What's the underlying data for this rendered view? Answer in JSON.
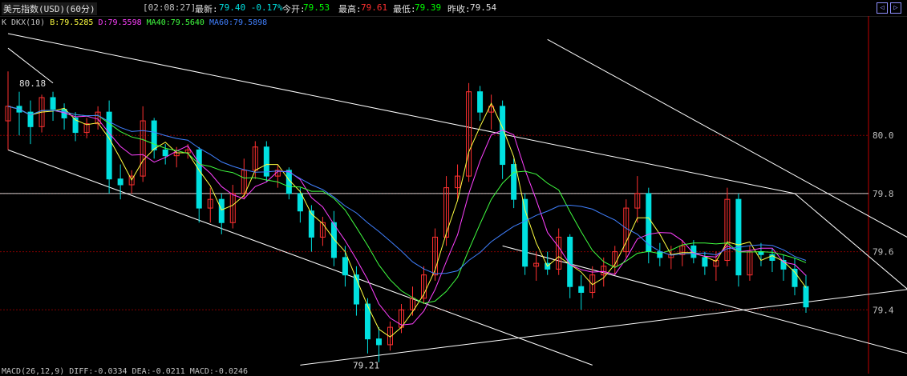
{
  "header": {
    "instrument": "美元指数(USD)(60分)",
    "time": "[02:08:27]",
    "last_label": "最新:",
    "last_value": "79.40 -0.17%",
    "open_label": "今开:",
    "open_value": "79.53",
    "high_label": "最高:",
    "high_value": "79.61",
    "low_label": "最低:",
    "low_value": "79.39",
    "prev_label": "昨收:",
    "prev_value": "79.54"
  },
  "nav": {
    "prev_icon": "◁",
    "next_icon": "▷"
  },
  "legend": {
    "prefix": "K  DKX(10) ",
    "b": "B:79.5285",
    "d": "D:79.5598",
    "ma40": "MA40:79.5640",
    "ma60": "MA60:79.5898"
  },
  "macd_text": "MACD(26,12,9) DIFF:-0.0334  DEA:-0.0211  MACD:-0.0246",
  "colors": {
    "up": "#ff3030",
    "down": "#00e0e0",
    "b_line": "#ffff40",
    "d_line": "#ff40ff",
    "ma40": "#40ff40",
    "ma60": "#4080ff",
    "grid": "#800000",
    "trend": "#ffffff"
  },
  "chart_data": {
    "type": "candlestick",
    "title": "美元指数(USD)(60分)",
    "ylim": [
      79.2,
      80.35
    ],
    "yticks": [
      80.0,
      79.8,
      79.6,
      79.4
    ],
    "ytick_labels": [
      "80.0",
      "79.8",
      "79.6",
      "79.4"
    ],
    "annotations": [
      {
        "text": "80.18",
        "value": 80.18
      },
      {
        "text": "79.21",
        "value": 79.21
      }
    ],
    "candles": [
      [
        80.05,
        80.22,
        79.95,
        80.1
      ],
      [
        80.1,
        80.15,
        80.0,
        80.08
      ],
      [
        80.08,
        80.12,
        79.97,
        80.03
      ],
      [
        80.03,
        80.14,
        80.01,
        80.13
      ],
      [
        80.13,
        80.15,
        80.05,
        80.09
      ],
      [
        80.09,
        80.11,
        80.02,
        80.06
      ],
      [
        80.06,
        80.08,
        79.98,
        80.01
      ],
      [
        80.01,
        80.06,
        79.99,
        80.04
      ],
      [
        80.04,
        80.1,
        80.02,
        80.08
      ],
      [
        80.08,
        80.12,
        79.8,
        79.85
      ],
      [
        79.85,
        79.9,
        79.78,
        79.83
      ],
      [
        79.83,
        79.88,
        79.8,
        79.86
      ],
      [
        79.86,
        80.1,
        79.84,
        80.05
      ],
      [
        80.05,
        80.06,
        79.92,
        79.95
      ],
      [
        79.95,
        79.97,
        79.9,
        79.93
      ],
      [
        79.93,
        79.96,
        79.89,
        79.94
      ],
      [
        79.94,
        79.97,
        79.92,
        79.95
      ],
      [
        79.95,
        79.96,
        79.7,
        79.75
      ],
      [
        79.75,
        79.82,
        79.7,
        79.78
      ],
      [
        79.78,
        79.8,
        79.66,
        79.7
      ],
      [
        79.7,
        79.83,
        79.68,
        79.8
      ],
      [
        79.8,
        79.92,
        79.78,
        79.88
      ],
      [
        79.88,
        79.98,
        79.85,
        79.96
      ],
      [
        79.96,
        79.98,
        79.84,
        79.86
      ],
      [
        79.86,
        79.9,
        79.82,
        79.88
      ],
      [
        79.88,
        79.89,
        79.78,
        79.8
      ],
      [
        79.8,
        79.82,
        79.7,
        79.74
      ],
      [
        79.74,
        79.76,
        79.6,
        79.65
      ],
      [
        79.65,
        79.72,
        79.62,
        79.7
      ],
      [
        79.7,
        79.74,
        79.55,
        79.58
      ],
      [
        79.58,
        79.62,
        79.48,
        79.52
      ],
      [
        79.52,
        79.55,
        79.38,
        79.42
      ],
      [
        79.42,
        79.44,
        79.25,
        79.3
      ],
      [
        79.3,
        79.34,
        79.22,
        79.28
      ],
      [
        79.28,
        79.36,
        79.26,
        79.34
      ],
      [
        79.34,
        79.42,
        79.32,
        79.4
      ],
      [
        79.4,
        79.48,
        79.38,
        79.44
      ],
      [
        79.44,
        79.55,
        79.42,
        79.52
      ],
      [
        79.52,
        79.68,
        79.5,
        79.65
      ],
      [
        79.65,
        79.86,
        79.62,
        79.82
      ],
      [
        79.82,
        79.9,
        79.78,
        79.86
      ],
      [
        79.86,
        80.18,
        79.84,
        80.15
      ],
      [
        80.15,
        80.17,
        80.05,
        80.08
      ],
      [
        80.08,
        80.14,
        80.02,
        80.1
      ],
      [
        80.1,
        80.12,
        79.85,
        79.9
      ],
      [
        79.9,
        79.92,
        79.75,
        79.78
      ],
      [
        79.78,
        79.8,
        79.52,
        79.55
      ],
      [
        79.55,
        79.6,
        79.5,
        79.56
      ],
      [
        79.56,
        79.6,
        79.52,
        79.54
      ],
      [
        79.54,
        79.68,
        79.52,
        79.65
      ],
      [
        79.65,
        79.66,
        79.44,
        79.48
      ],
      [
        79.48,
        79.52,
        79.4,
        79.46
      ],
      [
        79.46,
        79.55,
        79.44,
        79.52
      ],
      [
        79.52,
        79.58,
        79.48,
        79.55
      ],
      [
        79.55,
        79.62,
        79.52,
        79.6
      ],
      [
        79.6,
        79.78,
        79.58,
        79.75
      ],
      [
        79.75,
        79.86,
        79.7,
        79.8
      ],
      [
        79.8,
        79.82,
        79.56,
        79.6
      ],
      [
        79.6,
        79.63,
        79.55,
        79.58
      ],
      [
        79.58,
        79.62,
        79.54,
        79.59
      ],
      [
        79.59,
        79.64,
        79.55,
        79.62
      ],
      [
        79.62,
        79.64,
        79.56,
        79.58
      ],
      [
        79.58,
        79.6,
        79.52,
        79.55
      ],
      [
        79.55,
        79.6,
        79.5,
        79.57
      ],
      [
        79.57,
        79.82,
        79.55,
        79.78
      ],
      [
        79.78,
        79.8,
        79.48,
        79.52
      ],
      [
        79.52,
        79.62,
        79.5,
        79.6
      ],
      [
        79.6,
        79.63,
        79.55,
        79.59
      ],
      [
        79.59,
        79.61,
        79.53,
        79.57
      ],
      [
        79.57,
        79.59,
        79.5,
        79.54
      ],
      [
        79.54,
        79.58,
        79.45,
        79.48
      ],
      [
        79.48,
        79.52,
        79.39,
        79.41
      ]
    ],
    "trendlines": 7,
    "legend": [
      "B",
      "D",
      "MA40",
      "MA60"
    ]
  }
}
